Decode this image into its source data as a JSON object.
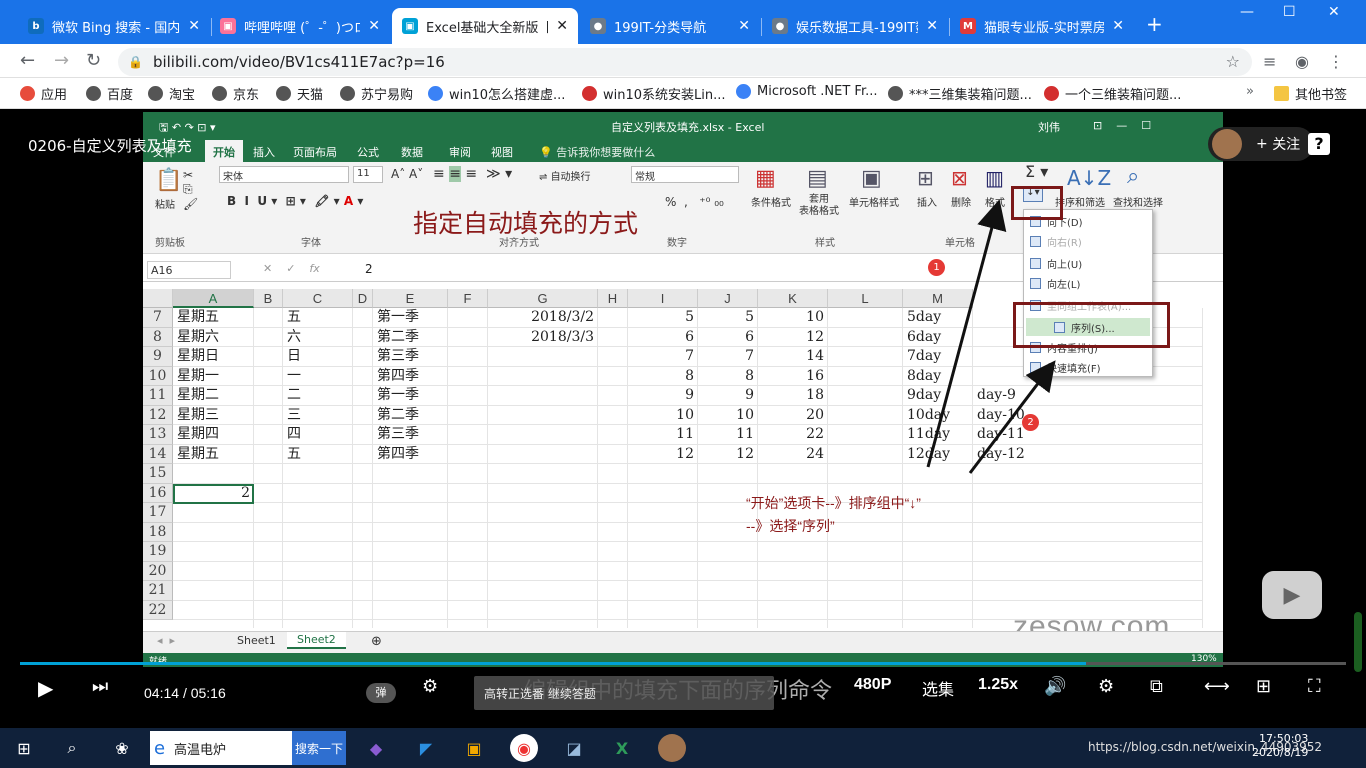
{
  "browser": {
    "tabs": [
      {
        "title": "微软 Bing 搜索 - 国内版",
        "icon": "bing-icon",
        "color": "#0f6cbd",
        "glyph": "b",
        "active": false
      },
      {
        "title": "哔哩哔哩 (゜-゜)つロ 干杯",
        "icon": "bilibili-icon",
        "color": "#fb7299",
        "glyph": "▣",
        "active": false
      },
      {
        "title": "Excel基础大全新版【完",
        "icon": "bilibili-icon",
        "color": "#00a1d6",
        "glyph": "▣",
        "active": true
      },
      {
        "title": "199IT-分类导航",
        "icon": "globe-icon",
        "color": "#6c7a89",
        "glyph": "●",
        "active": false
      },
      {
        "title": "娱乐数据工具-199IT数",
        "icon": "globe-icon",
        "color": "#6c7a89",
        "glyph": "●",
        "active": false
      },
      {
        "title": "猫眼专业版-实时票房",
        "icon": "maoyan-icon",
        "color": "#e03b3b",
        "glyph": "M",
        "active": false
      }
    ],
    "url": "bilibili.com/video/BV1cs411E7ac?p=16",
    "bookmarks": [
      {
        "label": "应用",
        "color": "#e74c3c"
      },
      {
        "label": "百度",
        "color": "#555"
      },
      {
        "label": "淘宝",
        "color": "#555"
      },
      {
        "label": "京东",
        "color": "#555"
      },
      {
        "label": "天猫",
        "color": "#555"
      },
      {
        "label": "苏宁易购",
        "color": "#555"
      },
      {
        "label": "win10怎么搭建虚...",
        "color": "#3b82f6"
      },
      {
        "label": "win10系统安装Lin...",
        "color": "#d32f2f"
      },
      {
        "label": "Microsoft .NET Fr...",
        "color": "#3b82f6"
      },
      {
        "label": "***三维集装箱问题...",
        "color": "#555"
      },
      {
        "label": "一个三维装箱问题...",
        "color": "#d32f2f"
      }
    ],
    "other_bookmarks": "其他书签"
  },
  "video": {
    "title": "0206-自定义列表及填充",
    "follow_label": "关注",
    "current_time": "04:14",
    "separator": "/",
    "duration": "05:16",
    "progress": 0.804,
    "danmaku_label": "弹",
    "quality": "480P",
    "episodes": "选集",
    "speed": "1.25x",
    "subtitle": "编辑组中的填充下面的序列命令",
    "toast_text": "高转正选番  继续答题",
    "toast_button": "继续答题",
    "watermark": "zesow.com"
  },
  "excel": {
    "title": "自定义列表及填充.xlsx - Excel",
    "user": "刘伟",
    "tabs": [
      "文件",
      "开始",
      "插入",
      "页面布局",
      "公式",
      "数据",
      "审阅",
      "视图"
    ],
    "tell_me": "告诉我你想要做什么",
    "font_name": "宋体",
    "font_size": "11",
    "number_format": "常规",
    "wrap_text": "自动换行",
    "groups": [
      "剪贴板",
      "字体",
      "对齐方式",
      "数字",
      "样式",
      "单元格"
    ],
    "ribbon_buttons": [
      "粘贴",
      "条件格式",
      "套用\n表格格式",
      "单元格样式",
      "插入",
      "删除",
      "格式",
      "排序和筛选",
      "查找和选择"
    ],
    "name_box": "A16",
    "formula": "2",
    "red_heading": "指定自动填充的方式",
    "columns": [
      "A",
      "B",
      "C",
      "D",
      "E",
      "F",
      "G",
      "H",
      "I",
      "J",
      "K",
      "L",
      "M"
    ],
    "rows": [
      {
        "n": "7",
        "a": "星期五",
        "c": "五",
        "e": "第一季",
        "g": "2018/3/2",
        "i": "5",
        "j": "5",
        "k": "10",
        "m": "5day"
      },
      {
        "n": "8",
        "a": "星期六",
        "c": "六",
        "e": "第二季",
        "g": "2018/3/3",
        "i": "6",
        "j": "6",
        "k": "12",
        "m": "6day"
      },
      {
        "n": "9",
        "a": "星期日",
        "c": "日",
        "e": "第三季",
        "g": "",
        "i": "7",
        "j": "7",
        "k": "14",
        "m": "7day"
      },
      {
        "n": "10",
        "a": "星期一",
        "c": "一",
        "e": "第四季",
        "g": "",
        "i": "8",
        "j": "8",
        "k": "16",
        "m": "8day"
      },
      {
        "n": "11",
        "a": "星期二",
        "c": "二",
        "e": "第一季",
        "g": "",
        "i": "9",
        "j": "9",
        "k": "18",
        "m": "9day",
        "n2": "day-9"
      },
      {
        "n": "12",
        "a": "星期三",
        "c": "三",
        "e": "第二季",
        "g": "",
        "i": "10",
        "j": "10",
        "k": "20",
        "m": "10day",
        "n2": "day-10"
      },
      {
        "n": "13",
        "a": "星期四",
        "c": "四",
        "e": "第三季",
        "g": "",
        "i": "11",
        "j": "11",
        "k": "22",
        "m": "11day",
        "n2": "day-11"
      },
      {
        "n": "14",
        "a": "星期五",
        "c": "五",
        "e": "第四季",
        "g": "",
        "i": "12",
        "j": "12",
        "k": "24",
        "m": "12day",
        "n2": "day-12"
      },
      {
        "n": "15"
      },
      {
        "n": "16",
        "a_right": "2"
      },
      {
        "n": "17"
      },
      {
        "n": "18"
      },
      {
        "n": "19"
      },
      {
        "n": "20"
      },
      {
        "n": "21"
      },
      {
        "n": "22"
      }
    ],
    "fill_menu": [
      {
        "label": "向下(D)",
        "disabled": false
      },
      {
        "label": "向右(R)",
        "disabled": true
      },
      {
        "label": "向上(U)",
        "disabled": false
      },
      {
        "label": "向左(L)",
        "disabled": false
      },
      {
        "label": "至同组工作表(A)...",
        "disabled": true
      },
      {
        "label": "序列(S)...",
        "disabled": false,
        "hover": true
      },
      {
        "label": "内容重排(J)",
        "disabled": false
      },
      {
        "label": "快速填充(F)",
        "disabled": false
      }
    ],
    "sheets": [
      "Sheet1",
      "Sheet2"
    ],
    "active_sheet": "Sheet2",
    "status_left": "就绪",
    "zoom": "130%",
    "annotation_line1": "“开始”选项卡--》排序组中“↓”",
    "annotation_line2": "--》选择“序列”",
    "badge1": "1",
    "badge2": "2"
  },
  "taskbar": {
    "search_text": "高温电炉",
    "search_button": "搜索一下",
    "time": "17:50:03",
    "date": "2020/8/19",
    "url_overlay": "https://blog.csdn.net/weixin_44903952"
  }
}
